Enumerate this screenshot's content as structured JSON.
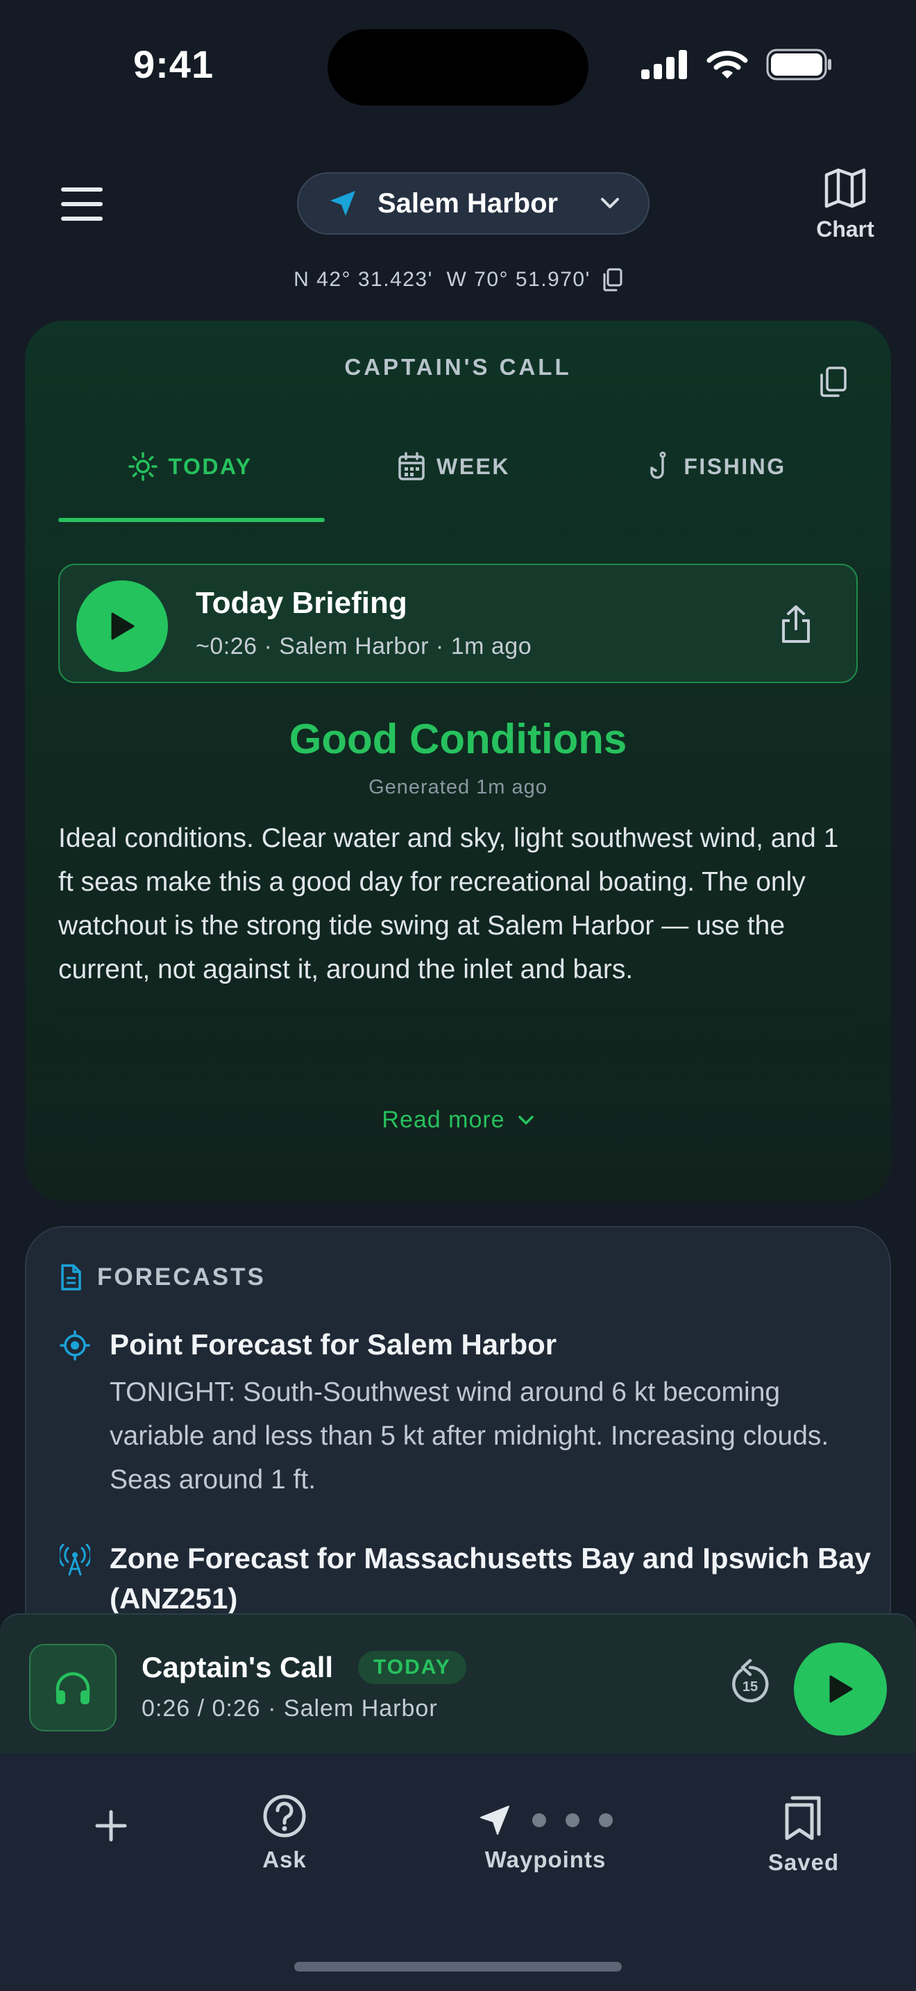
{
  "status_bar": {
    "time": "9:41"
  },
  "header": {
    "location": "Salem Harbor",
    "chart_label": "Chart",
    "coords": "N 42° 31.423'  W 70° 51.970'"
  },
  "captains_call": {
    "title": "CAPTAIN'S CALL",
    "tabs": [
      {
        "label": "TODAY",
        "icon": "sun-icon",
        "active": true
      },
      {
        "label": "WEEK",
        "icon": "calendar-icon",
        "active": false
      },
      {
        "label": "FISHING",
        "icon": "fishhook-icon",
        "active": false
      }
    ],
    "briefing": {
      "title": "Today Briefing",
      "subtitle": "~0:26 · Salem Harbor · 1m ago"
    },
    "condition": "Good Conditions",
    "generated": "Generated 1m ago",
    "summary": "Ideal conditions. Clear water and sky, light southwest wind, and 1 ft seas make this a good day for recreational boating. The only watchout is the strong tide swing at Salem Harbor — use the current, not against it, around the inlet and bars.",
    "read_more": "Read more"
  },
  "forecasts": {
    "title": "FORECASTS",
    "items": [
      {
        "icon": "crosshair-icon",
        "title": "Point Forecast for Salem Harbor",
        "body": "TONIGHT: South-Southwest wind around 6 kt becoming variable and less than 5 kt after midnight. Increasing clouds. Seas around 1 ft."
      },
      {
        "icon": "radio-tower-icon",
        "title": "Zone Forecast for Massachusetts Bay and Ipswich Bay (ANZ251)",
        "body": ""
      }
    ]
  },
  "player": {
    "title": "Captain's Call",
    "badge": "TODAY",
    "subtitle": "0:26 / 0:26 · Salem Harbor",
    "skip_seconds": "15"
  },
  "tabbar": {
    "items": [
      {
        "label": "",
        "icon": "plus-icon"
      },
      {
        "label": "Ask",
        "icon": "question-icon"
      },
      {
        "label": "Waypoints",
        "icon": "navigation-arrow-icon"
      },
      {
        "label": "Saved",
        "icon": "bookmarks-icon"
      }
    ]
  },
  "colors": {
    "accent_green": "#27c15e",
    "background": "#141b25",
    "card_green": "#102820",
    "card_dark": "#1f2835",
    "icon_blue": "#1aa3d9"
  }
}
